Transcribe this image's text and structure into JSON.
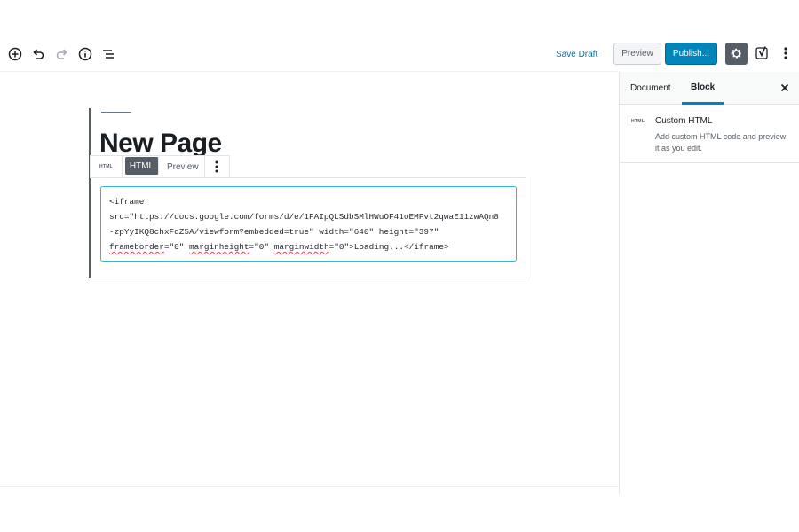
{
  "toolbar": {
    "save_draft_label": "Save Draft",
    "preview_label": "Preview",
    "publish_label": "Publish..."
  },
  "editor": {
    "page_title": "New Page",
    "block_toolbar": {
      "type_icon_label": "HTML",
      "tabs": [
        {
          "label": "HTML",
          "active": true
        },
        {
          "label": "Preview",
          "active": false
        }
      ]
    },
    "code": {
      "line1": "<iframe",
      "line2": "src=\"https://docs.google.com/forms/d/e/1FAIpQLSdbSMlHWuOF41oEMFvt2qwaE11zwAQn8",
      "line3": "-zpYyIKQ8chxFdZ5A/viewform?embedded=true\" width=\"640\" height=\"397\"",
      "line4_a": "frameborder",
      "line4_b": "=\"0\" ",
      "line4_c": "marginheight",
      "line4_d": "=\"0\" ",
      "line4_e": "marginwidth",
      "line4_f": "=\"0\">Loading...</iframe>"
    }
  },
  "sidebar": {
    "tabs": [
      {
        "label": "Document",
        "active": false
      },
      {
        "label": "Block",
        "active": true
      }
    ],
    "block_card": {
      "icon_label": "HTML",
      "title": "Custom HTML",
      "description": "Add custom HTML code and preview it as you edit."
    }
  },
  "colors": {
    "accent": "#0085ba",
    "link": "#0073aa",
    "dark": "#555d66",
    "focus_border": "#33b3db"
  }
}
